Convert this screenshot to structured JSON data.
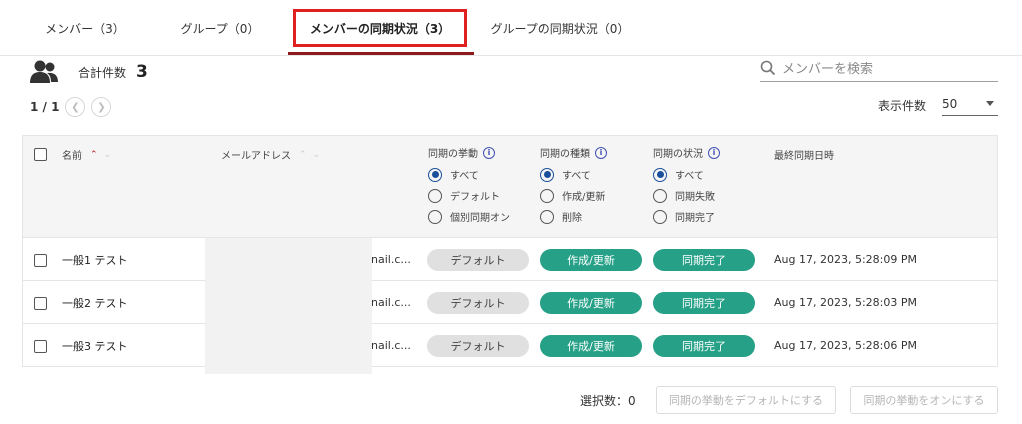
{
  "tabs": [
    {
      "label": "メンバー（3）"
    },
    {
      "label": "グループ（0）"
    },
    {
      "label": "メンバーの同期状況（3）"
    },
    {
      "label": "グループの同期状況（0）"
    }
  ],
  "summary": {
    "label": "合計件数",
    "count": "3"
  },
  "search": {
    "placeholder": "メンバーを検索"
  },
  "pagination": {
    "text": "1 / 1"
  },
  "page_size": {
    "label": "表示件数",
    "value": "50"
  },
  "table": {
    "headers": {
      "name": "名前",
      "email": "メールアドレス",
      "sync_behavior": "同期の挙動",
      "sync_type": "同期の種類",
      "sync_status": "同期の状況",
      "last_sync": "最終同期日時"
    },
    "filters": {
      "sync_behavior": [
        "すべて",
        "デフォルト",
        "個別同期オン"
      ],
      "sync_type": [
        "すべて",
        "作成/更新",
        "削除"
      ],
      "sync_status": [
        "すべて",
        "同期失敗",
        "同期完了"
      ]
    },
    "rows": [
      {
        "name": "一般1 テスト",
        "email": "nail.c...",
        "behavior": "デフォルト",
        "type": "作成/更新",
        "status": "同期完了",
        "date": "Aug 17, 2023, 5:28:09 PM"
      },
      {
        "name": "一般2 テスト",
        "email": "nail.c...",
        "behavior": "デフォルト",
        "type": "作成/更新",
        "status": "同期完了",
        "date": "Aug 17, 2023, 5:28:03 PM"
      },
      {
        "name": "一般3 テスト",
        "email": "nail.c...",
        "behavior": "デフォルト",
        "type": "作成/更新",
        "status": "同期完了",
        "date": "Aug 17, 2023, 5:28:06 PM"
      }
    ]
  },
  "footer": {
    "selected_label": "選択数：0",
    "btn_default": "同期の挙動をデフォルトにする",
    "btn_on": "同期の挙動をオンにする"
  },
  "colors": {
    "accent_red": "#e02020",
    "underline": "#8b1a1a",
    "green": "#26a086",
    "radio_blue": "#1a4f9c"
  }
}
